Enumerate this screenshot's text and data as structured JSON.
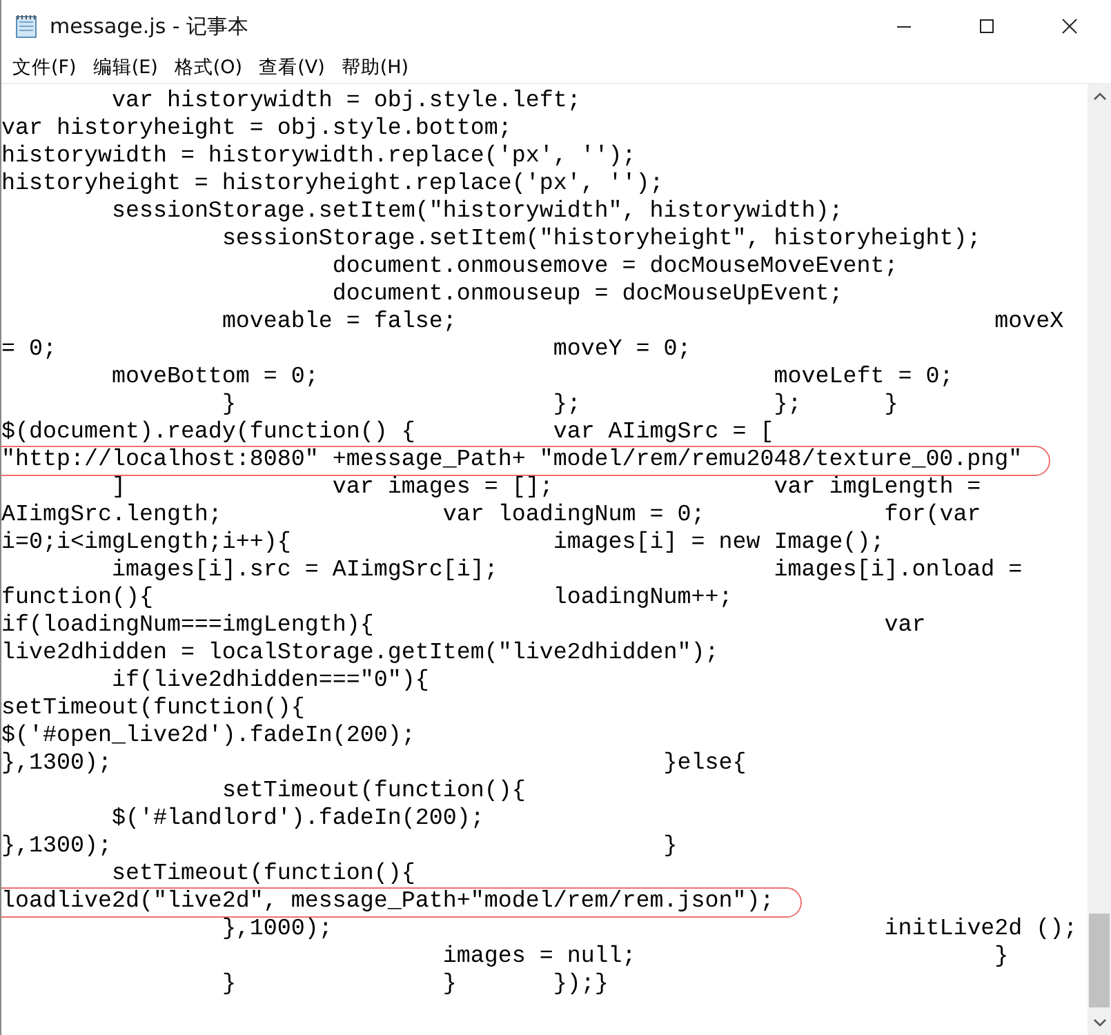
{
  "window": {
    "title": "message.js - 记事本"
  },
  "menu": [
    "文件(F)",
    "编辑(E)",
    "格式(O)",
    "查看(V)",
    "帮助(H)"
  ],
  "editor": {
    "lines": [
      {
        "text": "\tvar historywidth = obj.style.left;",
        "circled": false
      },
      {
        "text": "var historyheight = obj.style.bottom;",
        "circled": false
      },
      {
        "text": "historywidth = historywidth.replace('px', '');",
        "circled": false
      },
      {
        "text": "historyheight = historyheight.replace('px', '');",
        "circled": false
      },
      {
        "text": "\tsessionStorage.setItem(\"historywidth\", historywidth);",
        "circled": false
      },
      {
        "text": "\t\tsessionStorage.setItem(\"historyheight\", historyheight);",
        "circled": false
      },
      {
        "text": "\t\t\tdocument.onmousemove = docMouseMoveEvent;",
        "circled": false
      },
      {
        "text": "\t\t\tdocument.onmouseup = docMouseUpEvent;",
        "circled": false
      },
      {
        "text": "\t\tmoveable = false;\t\t\t\t\tmoveX",
        "circled": false
      },
      {
        "text": "= 0;\t\t\t\t\tmoveY = 0;",
        "circled": false
      },
      {
        "text": "\tmoveBottom = 0;\t\t\t\t\tmoveLeft = 0;",
        "circled": false
      },
      {
        "text": "\t\t}\t\t\t};\t\t};\t}",
        "circled": false
      },
      {
        "text": "$(document).ready(function() {\t\tvar AIimgSrc = [",
        "circled": false
      },
      {
        "text": "\"http://localhost:8080\" +message_Path+ \"model/rem/remu2048/texture_00.png\"",
        "circled": true
      },
      {
        "text": "\t]\t\tvar images = [];\t\tvar imgLength =",
        "circled": false
      },
      {
        "text": "AIimgSrc.length;\t\tvar loadingNum = 0;\t\tfor(var",
        "circled": false
      },
      {
        "text": "i=0;i<imgLength;i++){\t\t\timages[i] = new Image();",
        "circled": false
      },
      {
        "text": "\timages[i].src = AIimgSrc[i];\t\t\timages[i].onload =",
        "circled": false
      },
      {
        "text": "function(){\t\t\t\tloadingNum++;",
        "circled": false
      },
      {
        "text": "if(loadingNum===imgLength){\t\t\t\t\tvar",
        "circled": false
      },
      {
        "text": "live2dhidden = localStorage.getItem(\"live2dhidden\");",
        "circled": false
      },
      {
        "text": "\tif(live2dhidden===\"0\"){",
        "circled": false
      },
      {
        "text": "setTimeout(function(){",
        "circled": false
      },
      {
        "text": "$('#open_live2d').fadeIn(200);",
        "circled": false
      },
      {
        "text": "},1300);\t\t\t\t\t}else{",
        "circled": false
      },
      {
        "text": "\t\tsetTimeout(function(){",
        "circled": false
      },
      {
        "text": "\t$('#landlord').fadeIn(200);",
        "circled": false
      },
      {
        "text": "},1300);\t\t\t\t\t}",
        "circled": false
      },
      {
        "text": "\tsetTimeout(function(){",
        "circled": false
      },
      {
        "text": "loadlive2d(\"live2d\", message_Path+\"model/rem/rem.json\");",
        "circled": true
      },
      {
        "text": "\t\t},1000);\t\t\t\t\tinitLive2d ();",
        "circled": false
      },
      {
        "text": "\t\t\t\timages = null;\t\t\t\t}",
        "circled": false
      },
      {
        "text": "\t\t}\t\t}\t});}",
        "circled": false
      }
    ]
  }
}
